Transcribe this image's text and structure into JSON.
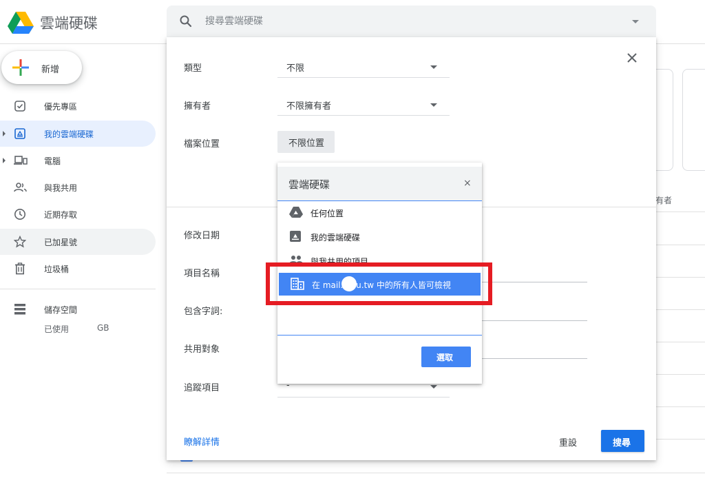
{
  "header": {
    "app_title": "雲端硬碟",
    "search_placeholder": "搜尋雲端硬碟"
  },
  "sidebar": {
    "new_label": "新增",
    "items": [
      {
        "label": "優先專區",
        "icon": "priority-icon"
      },
      {
        "label": "我的雲端硬碟",
        "icon": "my-drive-icon",
        "active": true
      },
      {
        "label": "電腦",
        "icon": "computers-icon"
      },
      {
        "label": "與我共用",
        "icon": "shared-icon"
      },
      {
        "label": "近期存取",
        "icon": "recent-icon"
      },
      {
        "label": "已加星號",
        "icon": "star-icon"
      },
      {
        "label": "垃圾桶",
        "icon": "trash-icon"
      }
    ],
    "storage": {
      "label": "儲存空間",
      "used_label": "已使用",
      "unit": "GB"
    }
  },
  "background": {
    "owner_header": "有者"
  },
  "search_panel": {
    "rows": {
      "type": {
        "label": "類型",
        "value": "不限"
      },
      "owner": {
        "label": "擁有者",
        "value": "不限擁有者"
      },
      "location": {
        "label": "檔案位置",
        "value": "不限位置"
      },
      "modified": {
        "label": "修改日期"
      },
      "item_name": {
        "label": "項目名稱"
      },
      "contains_words": {
        "label": "包含字詞:"
      },
      "shared_with": {
        "label": "共用對象"
      },
      "follow_up": {
        "label": "追蹤項目",
        "value": "-"
      }
    },
    "learn_more": "瞭解詳情",
    "reset_label": "重設",
    "search_label": "搜尋"
  },
  "location_popup": {
    "title": "雲端硬碟",
    "close": "×",
    "options": [
      {
        "label": "任何位置",
        "icon": "drive-logo-icon"
      },
      {
        "label": "我的雲端硬碟",
        "icon": "my-drive-icon"
      },
      {
        "label": "與我共用的項目",
        "icon": "shared-people-icon"
      },
      {
        "label": "在 mail.   edu.tw 中的所有人皆可檢視",
        "icon": "domain-building-icon",
        "selected": true
      }
    ],
    "select_label": "選取"
  },
  "colors": {
    "accent": "#1a73e8",
    "selected_option": "#4285f4",
    "highlight": "#e51c23",
    "active_nav_bg": "#e8f0fe"
  }
}
